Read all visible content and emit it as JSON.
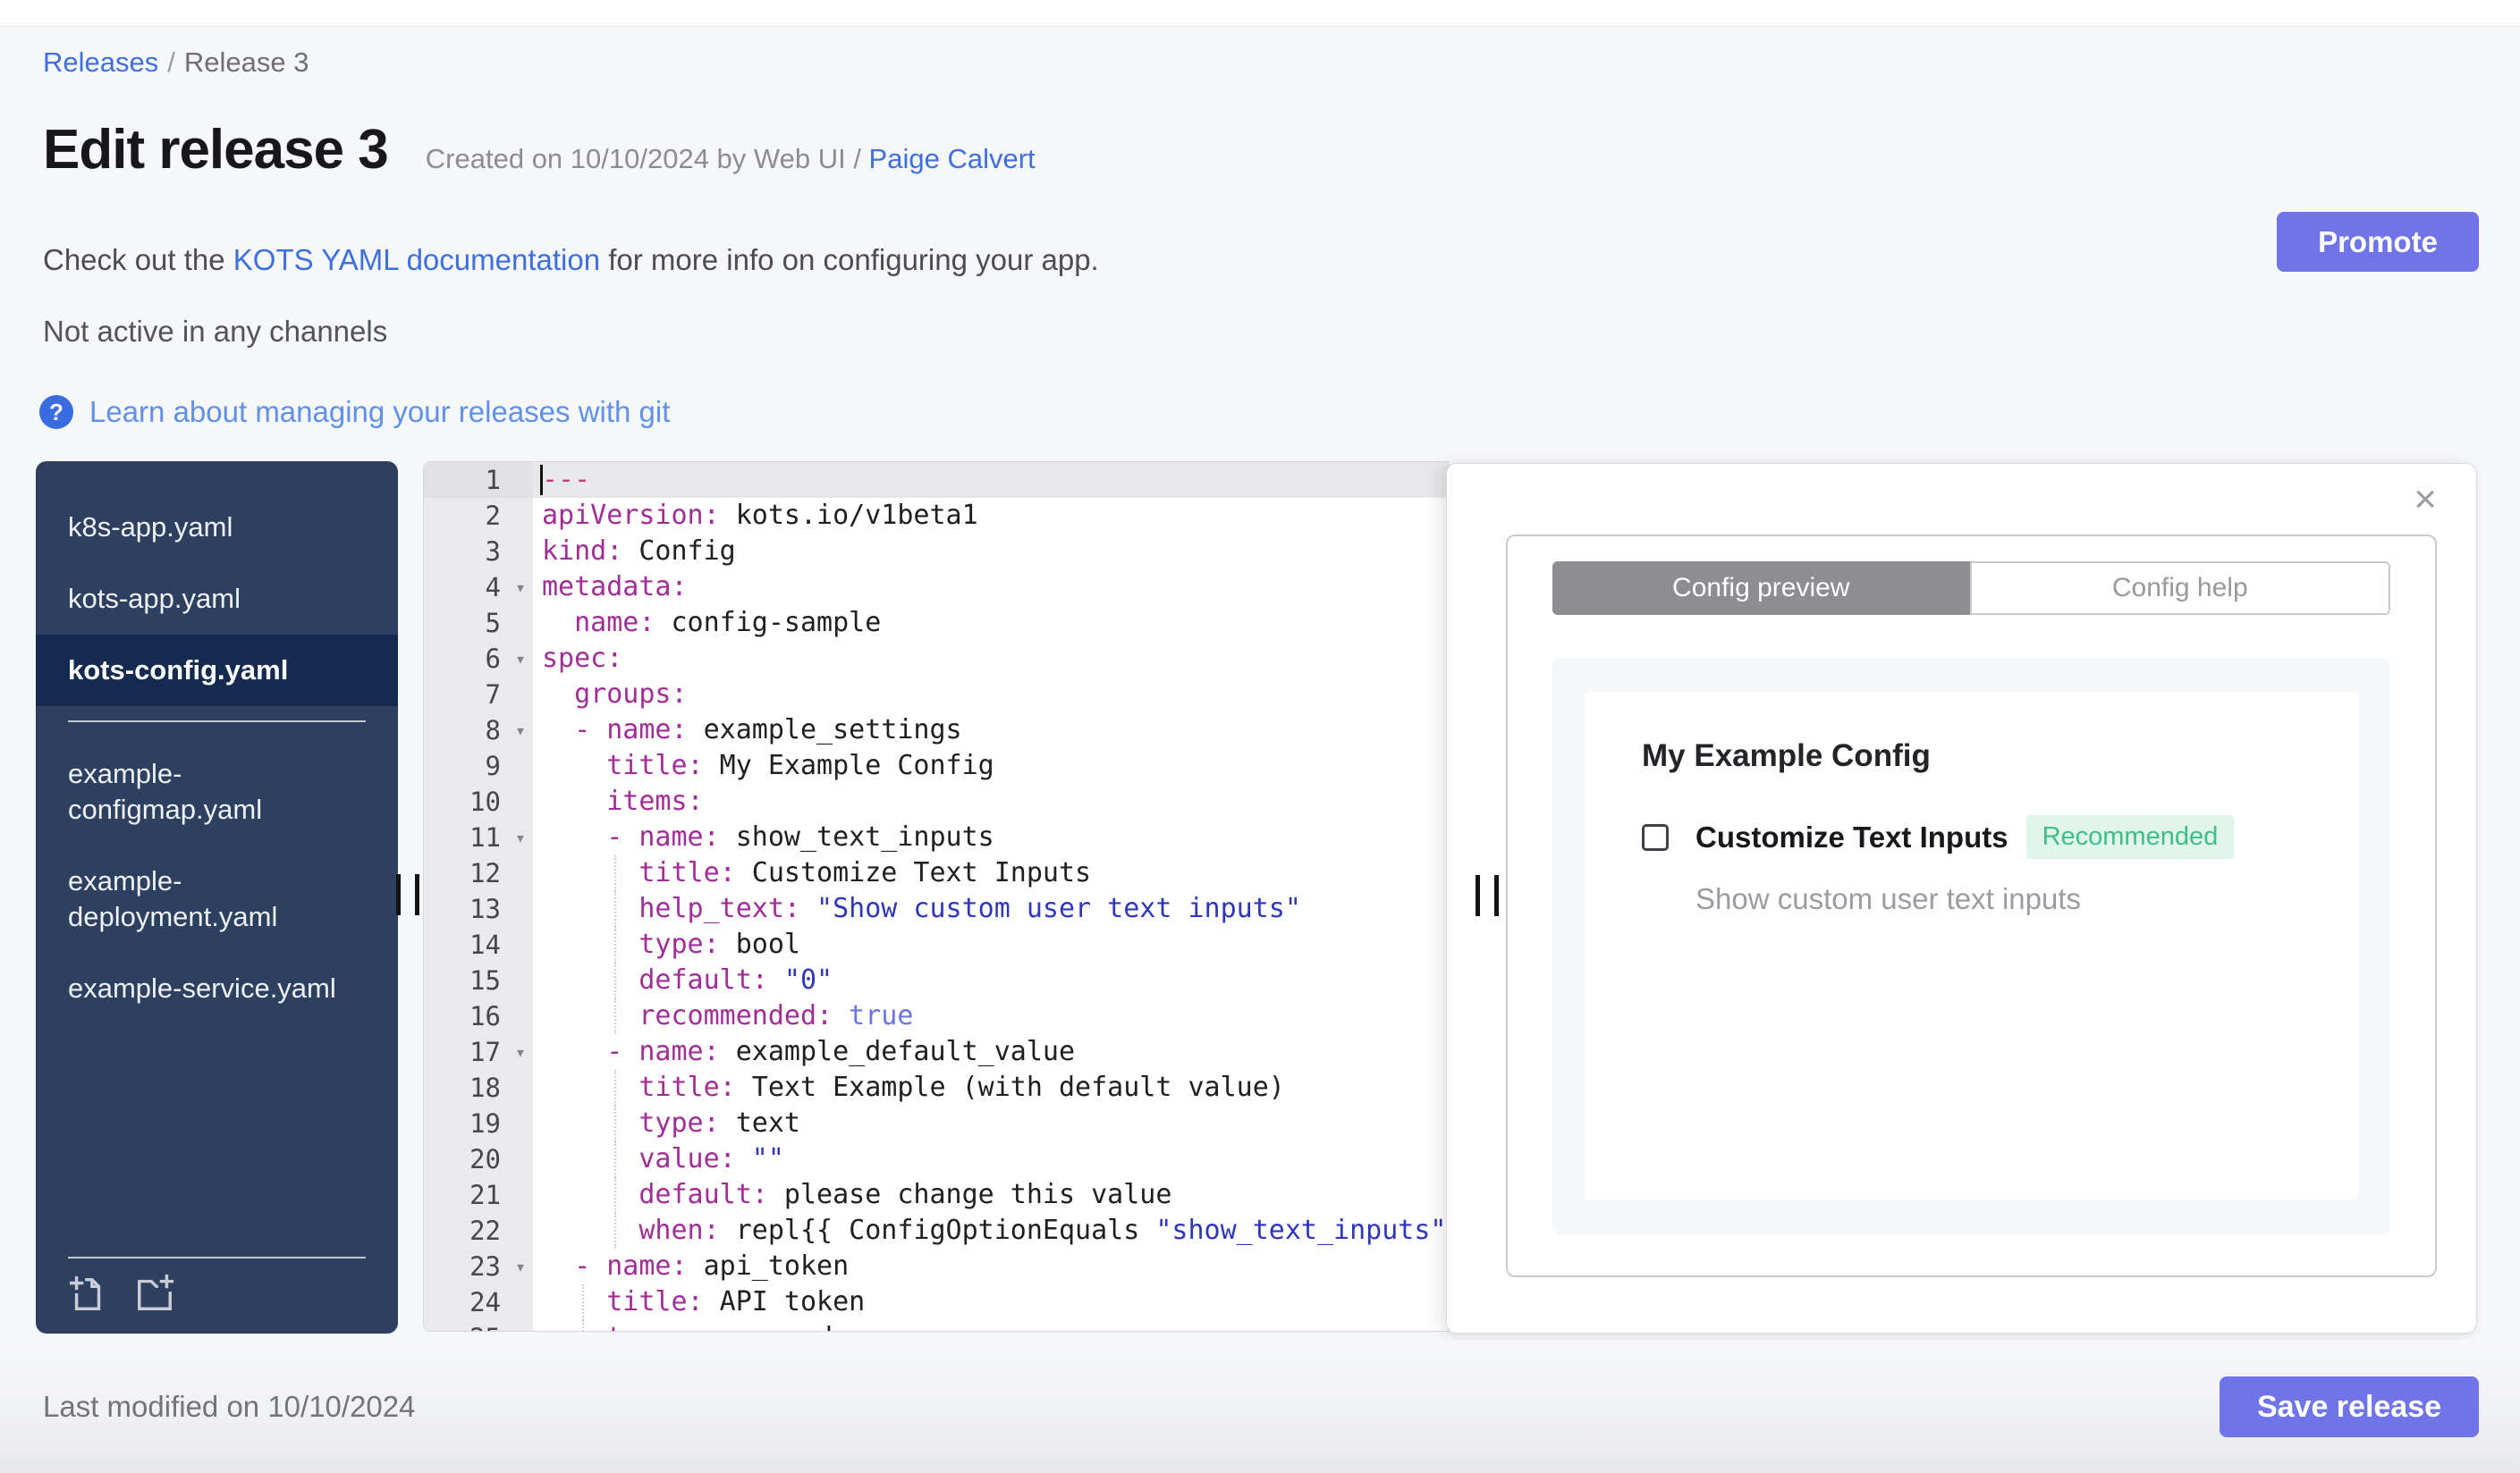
{
  "page": {
    "breadcrumb": {
      "link": "Releases",
      "separator": "/",
      "current": "Release 3"
    },
    "title": "Edit release 3",
    "subtitle_prefix": "Created on 10/10/2024 by Web UI / ",
    "subtitle_author": "Paige Calvert",
    "docs_prefix": "Check out the ",
    "docs_link": "KOTS YAML documentation",
    "docs_suffix": " for more info on configuring your app.",
    "status": "Not active in any channels",
    "git_icon": "?",
    "git_link": "Learn about managing your releases with git",
    "promote_button": "Promote",
    "last_modified": "Last modified on 10/10/2024",
    "save_button": "Save release"
  },
  "colors": {
    "primary_button": "#6f74e8",
    "link_blue": "#3e6fe2",
    "git_link_blue": "#6090ea",
    "sidebar_bg": "#2d4060",
    "sidebar_selected_bg": "#142a4e",
    "badge_green_text": "#3fbd85",
    "badge_green_bg": "#e1f6eb",
    "yaml_key": "#a12d96",
    "yaml_string": "#2f36bd",
    "yaml_bool": "#6b74e0",
    "yaml_doc_marker": "#c33e87"
  },
  "sidebar": {
    "groups": [
      [
        {
          "name": "k8s-app.yaml",
          "selected": false
        },
        {
          "name": "kots-app.yaml",
          "selected": false
        },
        {
          "name": "kots-config.yaml",
          "selected": true
        }
      ],
      [
        {
          "name": "example-configmap.yaml",
          "selected": false
        },
        {
          "name": "example-deployment.yaml",
          "selected": false
        },
        {
          "name": "example-service.yaml",
          "selected": false
        }
      ]
    ],
    "footer_icons": [
      "new-file-icon",
      "new-folder-icon"
    ]
  },
  "editor": {
    "lines": [
      {
        "active": true,
        "cursor": true,
        "tokens": [
          [
            "doc",
            "---"
          ]
        ]
      },
      {
        "tokens": [
          [
            "key",
            "apiVersion:"
          ],
          [
            "val",
            " kots.io/v1beta1"
          ]
        ]
      },
      {
        "tokens": [
          [
            "key",
            "kind:"
          ],
          [
            "val",
            " Config"
          ]
        ]
      },
      {
        "fold": true,
        "tokens": [
          [
            "key",
            "metadata:"
          ]
        ]
      },
      {
        "tokens": [
          [
            "sp",
            "  "
          ],
          [
            "key",
            "name:"
          ],
          [
            "val",
            " config-sample"
          ]
        ]
      },
      {
        "fold": true,
        "tokens": [
          [
            "key",
            "spec:"
          ]
        ]
      },
      {
        "tokens": [
          [
            "sp",
            "  "
          ],
          [
            "key",
            "groups:"
          ]
        ]
      },
      {
        "fold": true,
        "tokens": [
          [
            "sp",
            "  "
          ],
          [
            "dash",
            "- "
          ],
          [
            "key",
            "name:"
          ],
          [
            "val",
            " example_settings"
          ]
        ]
      },
      {
        "tokens": [
          [
            "sp",
            "    "
          ],
          [
            "key",
            "title:"
          ],
          [
            "val",
            " My Example Config"
          ]
        ]
      },
      {
        "tokens": [
          [
            "sp",
            "    "
          ],
          [
            "key",
            "items:"
          ]
        ]
      },
      {
        "fold": true,
        "tokens": [
          [
            "sp",
            "    "
          ],
          [
            "dash",
            "- "
          ],
          [
            "key",
            "name:"
          ],
          [
            "val",
            " show_text_inputs"
          ]
        ]
      },
      {
        "guide": 4.5,
        "tokens": [
          [
            "sp",
            "      "
          ],
          [
            "key",
            "title:"
          ],
          [
            "val",
            " Customize Text Inputs"
          ]
        ]
      },
      {
        "guide": 4.5,
        "tokens": [
          [
            "sp",
            "      "
          ],
          [
            "key",
            "help_text:"
          ],
          [
            "str",
            " \"Show custom user text inputs\""
          ]
        ]
      },
      {
        "guide": 4.5,
        "tokens": [
          [
            "sp",
            "      "
          ],
          [
            "key",
            "type:"
          ],
          [
            "val",
            " bool"
          ]
        ]
      },
      {
        "guide": 4.5,
        "tokens": [
          [
            "sp",
            "      "
          ],
          [
            "key",
            "default:"
          ],
          [
            "str",
            " \"0\""
          ]
        ]
      },
      {
        "guide": 4.5,
        "tokens": [
          [
            "sp",
            "      "
          ],
          [
            "key",
            "recommended:"
          ],
          [
            "bool",
            " true"
          ]
        ]
      },
      {
        "fold": true,
        "tokens": [
          [
            "sp",
            "    "
          ],
          [
            "dash",
            "- "
          ],
          [
            "key",
            "name:"
          ],
          [
            "val",
            " example_default_value"
          ]
        ]
      },
      {
        "guide": 4.5,
        "tokens": [
          [
            "sp",
            "      "
          ],
          [
            "key",
            "title:"
          ],
          [
            "val",
            " Text Example (with default value)"
          ]
        ]
      },
      {
        "guide": 4.5,
        "tokens": [
          [
            "sp",
            "      "
          ],
          [
            "key",
            "type:"
          ],
          [
            "val",
            " text"
          ]
        ]
      },
      {
        "guide": 4.5,
        "tokens": [
          [
            "sp",
            "      "
          ],
          [
            "key",
            "value:"
          ],
          [
            "str",
            " \"\""
          ]
        ]
      },
      {
        "guide": 4.5,
        "tokens": [
          [
            "sp",
            "      "
          ],
          [
            "key",
            "default:"
          ],
          [
            "val",
            " please change this value"
          ]
        ]
      },
      {
        "guide": 4.5,
        "tokens": [
          [
            "sp",
            "      "
          ],
          [
            "key",
            "when:"
          ],
          [
            "val",
            " repl{{ ConfigOptionEquals "
          ],
          [
            "str",
            "\"show_text_inputs\""
          ]
        ]
      },
      {
        "fold": true,
        "tokens": [
          [
            "sp",
            "  "
          ],
          [
            "dash",
            "- "
          ],
          [
            "key",
            "name:"
          ],
          [
            "val",
            " api_token"
          ]
        ]
      },
      {
        "guide": 2.5,
        "tokens": [
          [
            "sp",
            "    "
          ],
          [
            "key",
            "title:"
          ],
          [
            "val",
            " API token"
          ]
        ]
      },
      {
        "guide": 2.5,
        "tokens": [
          [
            "sp",
            "    "
          ],
          [
            "key",
            "type:"
          ],
          [
            "val",
            " password"
          ]
        ]
      }
    ]
  },
  "panel": {
    "close_icon": "×",
    "tabs": [
      {
        "label": "Config preview",
        "active": true
      },
      {
        "label": "Config help",
        "active": false
      }
    ],
    "config": {
      "group_title": "My Example Config",
      "item_label": "Customize Text Inputs",
      "item_badge": "Recommended",
      "item_help": "Show custom user text inputs",
      "item_checked": false
    }
  }
}
